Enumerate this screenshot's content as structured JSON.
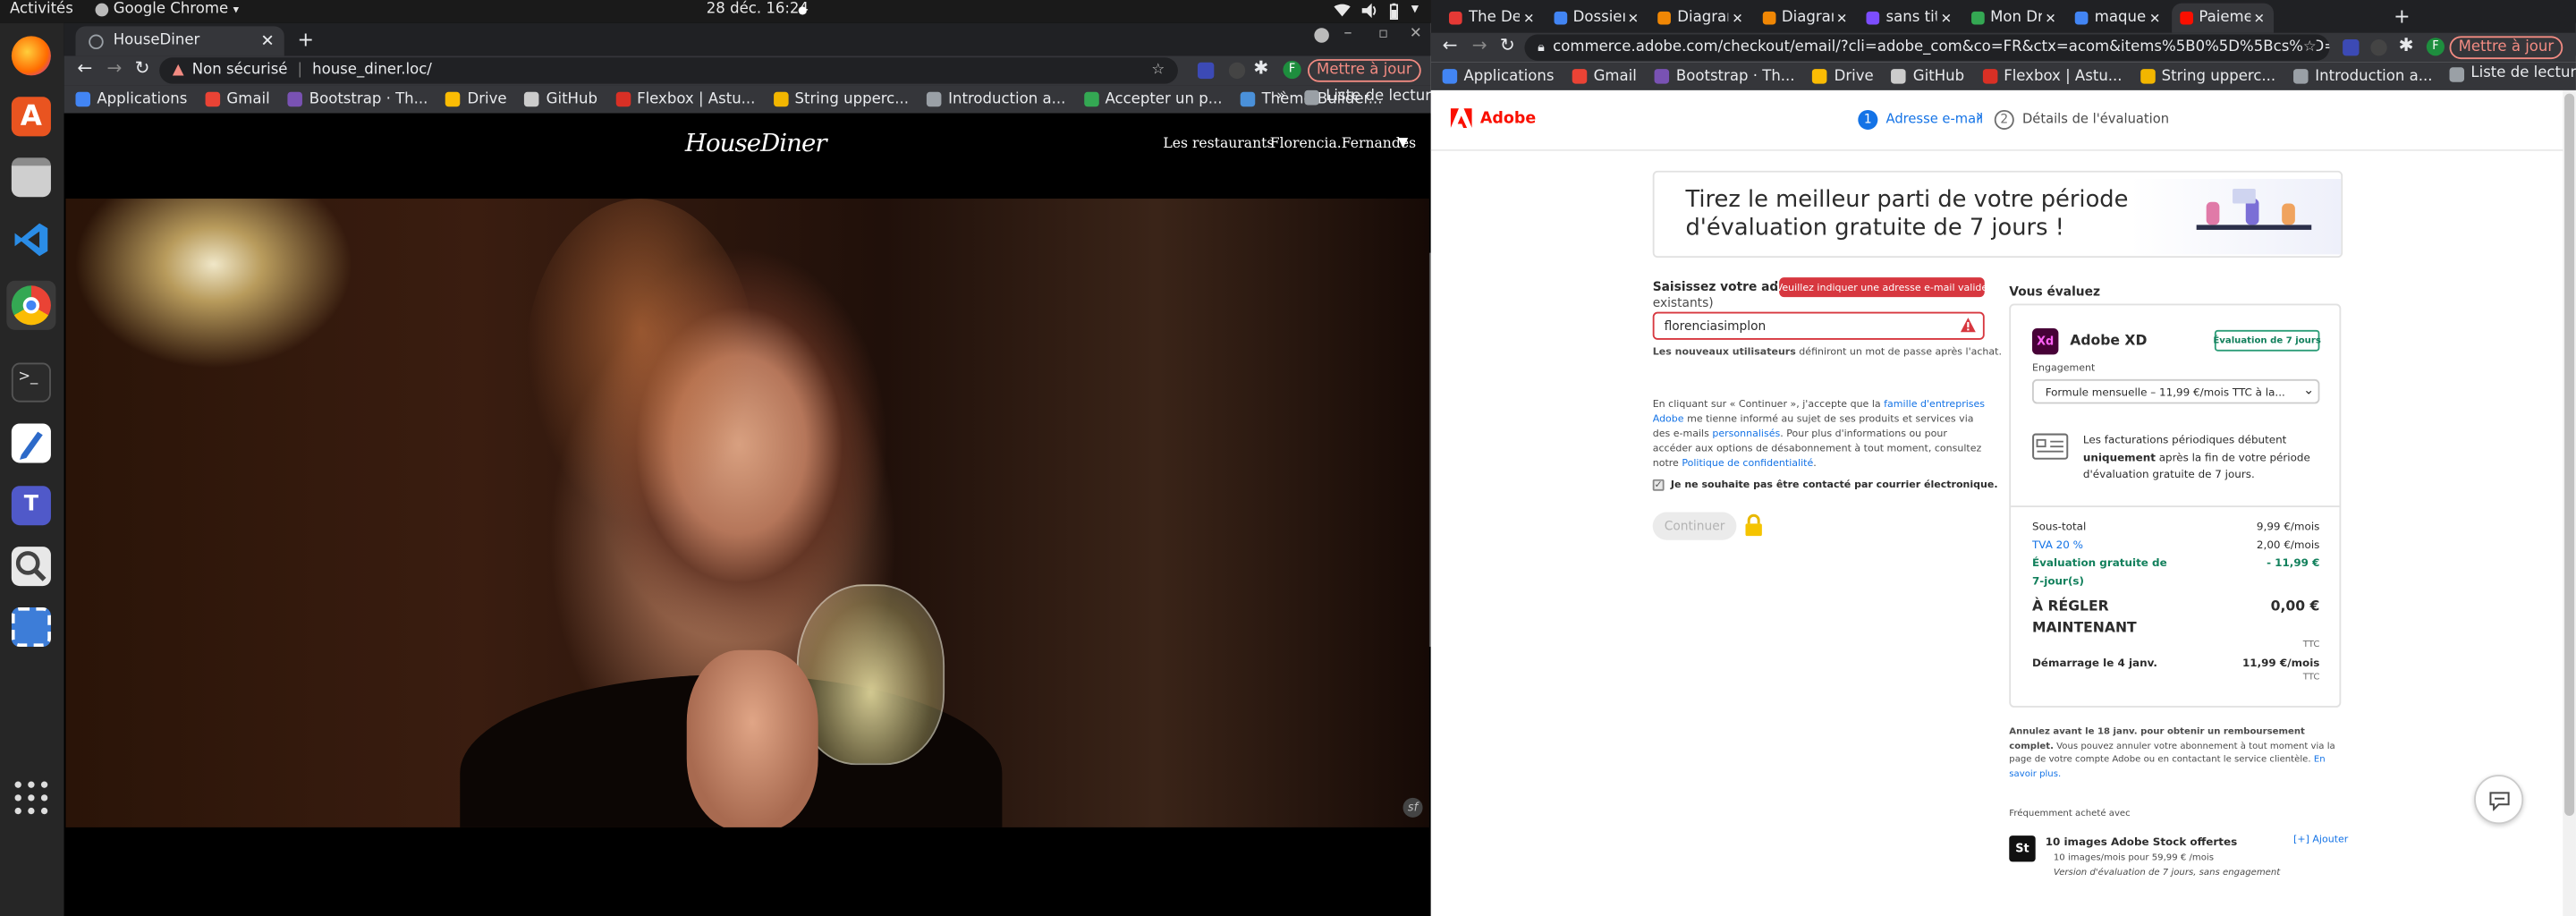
{
  "system_bar": {
    "activities": "Activités",
    "app_name": "Google Chrome",
    "clock": "28 déc.  16:24"
  },
  "left_browser": {
    "tab_title": "HouseDiner",
    "security": "Non sécurisé",
    "url": "house_diner.loc/",
    "update_label": "Mettre à jour",
    "bookmarks": [
      {
        "label": "Applications",
        "color": "#4285f4"
      },
      {
        "label": "Gmail",
        "color": "#ea4335"
      },
      {
        "label": "Bootstrap · Th...",
        "color": "#7952b3"
      },
      {
        "label": "Drive",
        "color": "#fbbc04"
      },
      {
        "label": "GitHub",
        "color": "#cccccc"
      },
      {
        "label": "Flexbox | Astu...",
        "color": "#d93025"
      },
      {
        "label": "String upperc...",
        "color": "#f2b600"
      },
      {
        "label": "Introduction a...",
        "color": "#9aa0a6"
      },
      {
        "label": "Accepter un p...",
        "color": "#34a853"
      },
      {
        "label": "Thème Builder...",
        "color": "#4a90d9"
      }
    ],
    "reading_list": "Liste de lecture",
    "site": {
      "logo": "HouseDiner",
      "nav_restaurants": "Les restaurants",
      "nav_user": "Florencia.Fernandes"
    }
  },
  "right_browser": {
    "tabs": [
      {
        "label": "The Devil",
        "color": "#e53935"
      },
      {
        "label": "Dossier_p",
        "color": "#4285f4"
      },
      {
        "label": "Diagramm",
        "color": "#f08705"
      },
      {
        "label": "Diagramm",
        "color": "#f08705"
      },
      {
        "label": "sans titre",
        "color": "#7c4dff"
      },
      {
        "label": "Mon Drive",
        "color": "#34a853"
      },
      {
        "label": "maquette",
        "color": "#4285f4"
      },
      {
        "label": "Paiemen",
        "color": "#fa0f00"
      }
    ],
    "url": "commerce.adobe.com/checkout/email/?cli=adobe_com&co=FR&ctx=acom&items%5B0%5D%5Bcs%5D=0&items%5B0%5D%5Bi...",
    "update_label": "Mettre à jour",
    "bookmarks": [
      {
        "label": "Applications",
        "color": "#4285f4"
      },
      {
        "label": "Gmail",
        "color": "#ea4335"
      },
      {
        "label": "Bootstrap · Th...",
        "color": "#7952b3"
      },
      {
        "label": "Drive",
        "color": "#fbbc04"
      },
      {
        "label": "GitHub",
        "color": "#cccccc"
      },
      {
        "label": "Flexbox | Astu...",
        "color": "#d93025"
      },
      {
        "label": "String upperc...",
        "color": "#f2b600"
      },
      {
        "label": "Introduction a...",
        "color": "#9aa0a6"
      }
    ],
    "reading_list": "Liste de lecture"
  },
  "adobe": {
    "brand": "Adobe",
    "step1_num": "1",
    "step1": "Adresse e-mail",
    "step2_num": "2",
    "step2": "Détails de l'évaluation",
    "banner_line1": "Tirez le meilleur parti de votre période",
    "banner_line2": "d'évaluation gratuite de 7 jours !",
    "email_label_1": "Saisissez votre adresse e",
    "email_label_2": "existants)",
    "tooltip": "Veuillez indiquer une adresse e-mail valide",
    "email_value": "florenciasimplon",
    "new_users_bold": "Les nouveaux utilisateurs",
    "new_users_rest": " définiront un mot de passe après l'achat.",
    "legal": [
      {
        "t": "En cliquant sur « Continuer », j'accepte que la "
      },
      {
        "t": "famille d'entreprises Adobe",
        "link": true
      },
      {
        "t": " me tienne informé au sujet de ses produits et services via des e-mails "
      },
      {
        "t": "personnalisés",
        "link": true
      },
      {
        "t": ". Pour plus d'informations ou pour accéder aux options de désabonnement à tout moment, consultez notre "
      },
      {
        "t": "Politique de confidentialité",
        "link": true
      },
      {
        "t": "."
      }
    ],
    "checkbox_label": "Je ne souhaite pas être contacté par courrier électronique.",
    "continue": "Continuer",
    "summary_title": "Vous évaluez",
    "product": "Adobe XD",
    "product_icon": "Xd",
    "trial_badge": "Évaluation de 7 jours",
    "engagement_label": "Engagement",
    "plan_select": "Formule mensuelle  –  11,99 €/mois  TTC  à la...",
    "billing_info_1": "Les facturations périodiques débutent ",
    "billing_info_bold": "uniquement",
    "billing_info_2": " après la fin de votre période d'évaluation gratuite de 7 jours.",
    "subtotal_label": "Sous-total",
    "subtotal_value": "9,99 €/mois",
    "vat_label": "TVA 20 %",
    "vat_value": "2,00 €/mois",
    "trial_label_1": "Évaluation gratuite de",
    "trial_label_2": "7-jour(s)",
    "trial_value": "- 11,99 €",
    "due_label_1": "À RÉGLER",
    "due_label_2": "MAINTENANT",
    "due_value": "0,00 €",
    "due_ttc": "TTC",
    "start_label": "Démarrage le 4 janv.",
    "start_value": "11,99 €/mois",
    "start_ttc": "TTC",
    "cancel_text": "Annulez avant le 18 janv. pour obtenir un remboursement complet.",
    "cancel_text_2": " Vous pouvez annuler votre abonnement à tout moment via la page de votre compte Adobe ou en contactant le service clientèle. ",
    "learn_more": "En savoir plus.",
    "bought_with": "Fréquemment acheté avec",
    "stock_icon": "St",
    "stock_title": "10 images Adobe Stock offertes",
    "stock_line1": "10 images/mois pour 59,99 € /mois",
    "stock_line2": "Version d'évaluation de 7 jours, sans engagement",
    "add_label": "[+] Ajouter"
  }
}
